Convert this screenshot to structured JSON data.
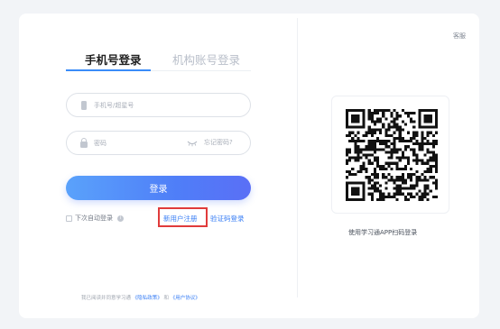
{
  "tabs": {
    "phone": "手机号登录",
    "org": "机构账号登录"
  },
  "form": {
    "phone_placeholder": "手机号/超星号",
    "password_placeholder": "密码",
    "forgot": "忘记密码?",
    "login_button": "登录",
    "remember": "下次自动登录",
    "register": "新用户注册",
    "code_login": "验证码登录"
  },
  "agreement": {
    "prefix": "我已阅读并同意学习通",
    "privacy": "《隐私政策》",
    "and": "和",
    "terms": "《用户协议》"
  },
  "right": {
    "service": "客服",
    "qr_caption": "使用学习通APP扫码登录"
  },
  "colors": {
    "accent": "#3a8cf9",
    "highlight": "#e03b3b"
  }
}
